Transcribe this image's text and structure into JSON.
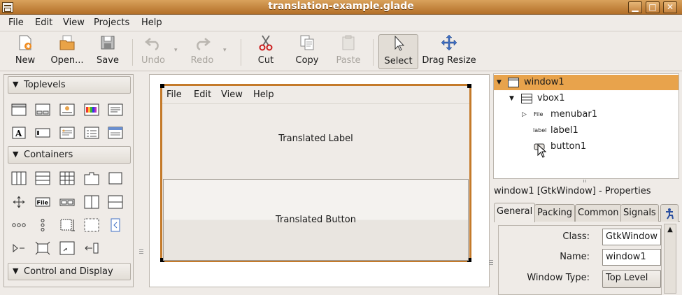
{
  "window": {
    "title": "translation-example.glade",
    "min_label": "▁",
    "max_label": "□",
    "close_label": "✕"
  },
  "menubar": {
    "file": "File",
    "edit": "Edit",
    "view": "View",
    "projects": "Projects",
    "help": "Help"
  },
  "toolbar": {
    "new": "New",
    "open": "Open...",
    "save": "Save",
    "undo": "Undo",
    "redo": "Redo",
    "cut": "Cut",
    "copy": "Copy",
    "paste": "Paste",
    "select": "Select",
    "drag_resize": "Drag Resize"
  },
  "palette": {
    "toplevels": "Toplevels",
    "containers": "Containers",
    "control_and_display": "Control and Display",
    "file_icon_text": "File",
    "file_icon_text2": "File"
  },
  "designer": {
    "menu": {
      "file": "File",
      "edit": "Edit",
      "view": "View",
      "help": "Help"
    },
    "label": "Translated Label",
    "button": "Translated Button"
  },
  "tree": {
    "items": [
      {
        "name": "window1"
      },
      {
        "name": "vbox1"
      },
      {
        "name": "menubar1",
        "badge": "File"
      },
      {
        "name": "label1",
        "badge": "label"
      },
      {
        "name": "button1"
      }
    ]
  },
  "properties": {
    "title": "window1 [GtkWindow] - Properties",
    "tabs": [
      "General",
      "Packing",
      "Common",
      "Signals"
    ],
    "rows": [
      {
        "label": "Class:",
        "value": "GtkWindow"
      },
      {
        "label": "Name:",
        "value": "window1"
      },
      {
        "label": "Window Type:",
        "value": "Top Level"
      }
    ]
  },
  "colors": {
    "selection": "#e8a34c",
    "titlebar": "#c47a2a"
  }
}
